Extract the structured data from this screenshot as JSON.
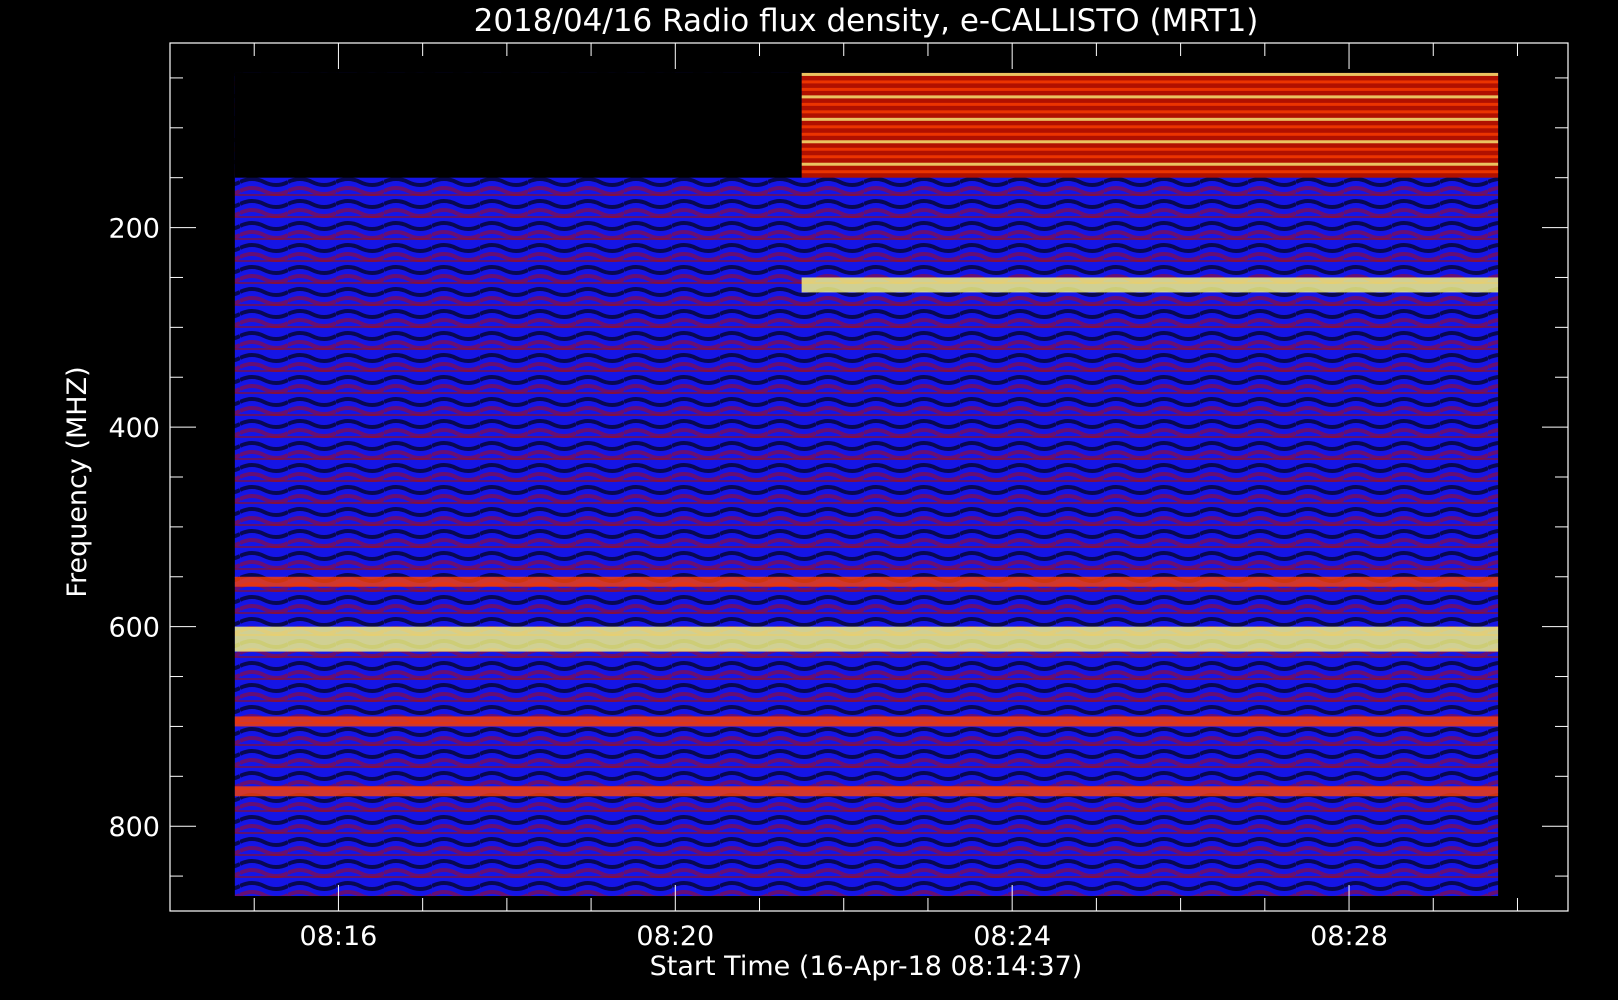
{
  "chart_data": {
    "type": "heatmap",
    "title": "2018/04/16  Radio flux density, e-CALLISTO (MRT1)",
    "xlabel": "Start Time (16-Apr-18 08:14:37)",
    "ylabel": "Frequency (MHZ)",
    "x_range_minutes": [
      14.0,
      30.6
    ],
    "data_x_range_minutes": [
      14.77,
      29.77
    ],
    "y_range_mhz": [
      15,
      885
    ],
    "data_y_range_mhz": [
      45,
      870
    ],
    "y_axis_inverted": true,
    "x_ticks": [
      {
        "minute": 16,
        "label": "08:16"
      },
      {
        "minute": 20,
        "label": "08:20"
      },
      {
        "minute": 24,
        "label": "08:24"
      },
      {
        "minute": 28,
        "label": "08:28"
      }
    ],
    "x_minor_ticks_minutes": [
      15,
      17,
      18,
      19,
      21,
      22,
      23,
      25,
      26,
      27,
      29,
      30
    ],
    "y_ticks": [
      {
        "mhz": 200,
        "label": "200"
      },
      {
        "mhz": 400,
        "label": "400"
      },
      {
        "mhz": 600,
        "label": "600"
      },
      {
        "mhz": 800,
        "label": "800"
      }
    ],
    "y_minor_ticks_mhz": [
      50,
      100,
      150,
      250,
      300,
      350,
      450,
      500,
      550,
      650,
      700,
      750,
      850
    ],
    "colormap": [
      "#000000",
      "#0000ff",
      "#b01000",
      "#ff4000",
      "#ffff80"
    ],
    "features": [
      {
        "name": "low band saturated emission",
        "x_minutes": [
          21.5,
          29.77
        ],
        "y_mhz": [
          45,
          150
        ],
        "intensity": "high"
      },
      {
        "name": "no data gap",
        "x_minutes": [
          14.77,
          21.5
        ],
        "y_mhz": [
          45,
          150
        ],
        "intensity": "none"
      },
      {
        "name": "emission band",
        "x_minutes": [
          21.5,
          29.77
        ],
        "y_mhz": [
          250,
          265
        ],
        "intensity": "high"
      },
      {
        "name": "interference line",
        "x_minutes": [
          14.77,
          29.77
        ],
        "y_mhz": [
          600,
          625
        ],
        "intensity": "high"
      },
      {
        "name": "interference line",
        "x_minutes": [
          14.77,
          29.77
        ],
        "y_mhz": [
          550,
          560
        ],
        "intensity": "medium"
      },
      {
        "name": "interference line",
        "x_minutes": [
          14.77,
          29.77
        ],
        "y_mhz": [
          690,
          700
        ],
        "intensity": "medium"
      },
      {
        "name": "interference line",
        "x_minutes": [
          14.77,
          29.77
        ],
        "y_mhz": [
          760,
          770
        ],
        "intensity": "medium"
      }
    ]
  }
}
